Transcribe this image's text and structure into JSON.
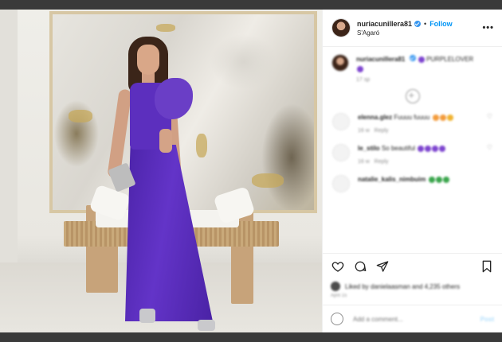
{
  "header": {
    "username": "nuriacunillera81",
    "dot": "•",
    "follow_label": "Follow",
    "location": "S'Agaró",
    "more_label": "•••"
  },
  "caption": {
    "username": "nuriacunillera81",
    "text": "PURPLELOVER",
    "time": "17 sp"
  },
  "comments": [
    {
      "username": "elenna.glez",
      "text": "Fuuuu fuuuu",
      "emoji": [
        "orange",
        "orange",
        "yellow"
      ],
      "time": "16 w",
      "reply": "Reply"
    },
    {
      "username": "le_stilo",
      "text": "So beautiful",
      "emoji": [
        "purple",
        "purple",
        "purple",
        "purple"
      ],
      "time": "16 w",
      "reply": "Reply"
    },
    {
      "username": "natalie_kalis_nimbuim",
      "text": "",
      "emoji": [
        "green",
        "green",
        "green"
      ],
      "time": "",
      "reply": ""
    }
  ],
  "actions": {
    "like": "heart-icon",
    "comment": "comment-icon",
    "share": "share-icon",
    "save": "bookmark-icon"
  },
  "likes": {
    "text": "Liked by danielaasman and 4,235 others"
  },
  "date": "April 15",
  "add_comment": {
    "placeholder": "Add a comment...",
    "post_label": "Post"
  }
}
